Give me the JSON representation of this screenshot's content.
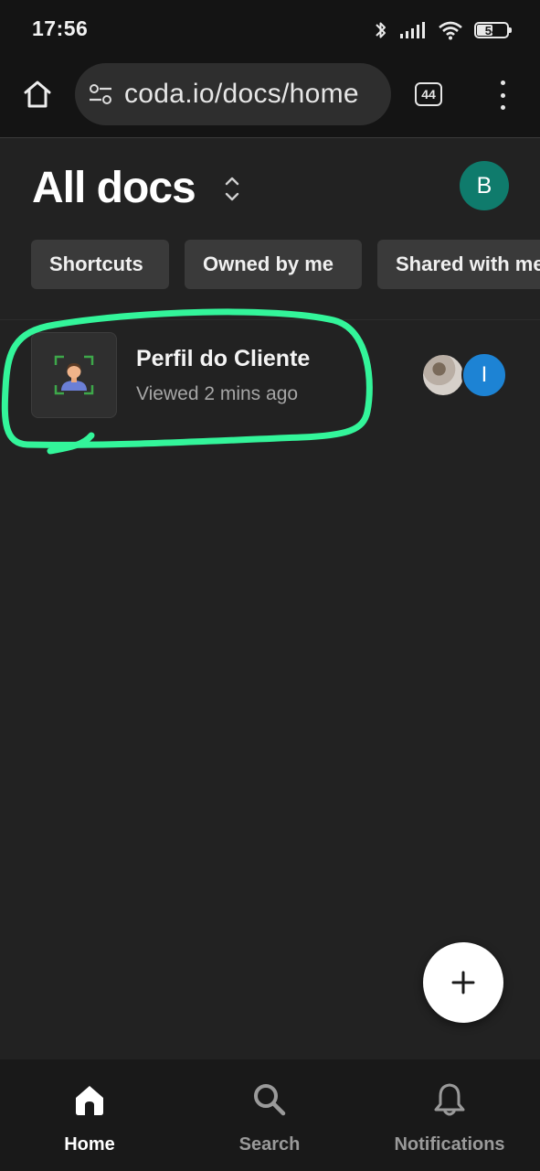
{
  "status_bar": {
    "time": "17:56",
    "battery": "54",
    "battery_level": 0.54,
    "icons": [
      "bluetooth-icon",
      "signal-icon",
      "wifi-icon",
      "battery-icon"
    ]
  },
  "browser": {
    "url": "coda.io/docs/home",
    "tab_count": "44",
    "icons": [
      "home-icon",
      "site-settings-icon",
      "tabs-icon",
      "more-vert-icon"
    ]
  },
  "header": {
    "title": "All docs",
    "avatar_initial": "B",
    "avatar_color": "#0f7b6c"
  },
  "filters": [
    {
      "label": "Shortcuts"
    },
    {
      "label": "Owned by me"
    },
    {
      "label": "Shared with me"
    }
  ],
  "docs": [
    {
      "title": "Perfil do Cliente",
      "subtitle": "Viewed 2 mins ago",
      "icon": "user-profile-icon",
      "collaborators": [
        {
          "type": "photo"
        },
        {
          "initial": "I",
          "color": "#1d83d4"
        }
      ]
    }
  ],
  "annotation": {
    "color": "#33f59a"
  },
  "fab": {
    "icon": "plus-icon"
  },
  "bottom_nav": [
    {
      "label": "Home",
      "icon": "home-icon",
      "active": true
    },
    {
      "label": "Search",
      "icon": "search-icon",
      "active": false
    },
    {
      "label": "Notifications",
      "icon": "bell-icon",
      "active": false
    }
  ],
  "colors": {
    "background": "#222222",
    "chrome": "#141414",
    "chip": "#3a3a3a",
    "nav_active": "#ffffff",
    "nav_inactive": "#9a9a9a"
  }
}
